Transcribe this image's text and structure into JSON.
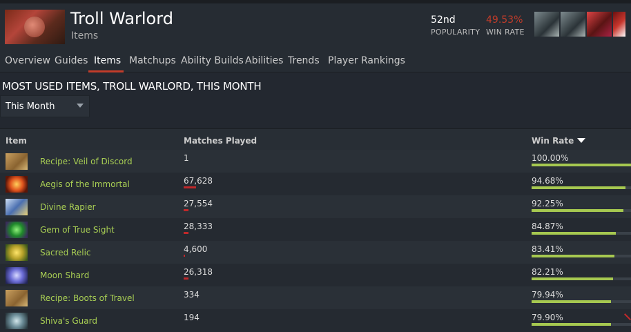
{
  "hero": {
    "name": "Troll Warlord",
    "subtitle": "Items",
    "popularity_value": "52nd",
    "popularity_label": "POPULARITY",
    "winrate_value": "49.53%",
    "winrate_label": "WIN RATE"
  },
  "nav": {
    "tabs": [
      "Overview",
      "Guides",
      "Items",
      "Matchups",
      "Ability Builds",
      "Abilities",
      "Trends",
      "Player Rankings"
    ],
    "active": "Items"
  },
  "section": {
    "title": "MOST USED ITEMS, TROLL WARLORD, THIS MONTH"
  },
  "filter": {
    "selected": "This Month"
  },
  "table": {
    "headers": {
      "item": "Item",
      "matches": "Matches Played",
      "winrate": "Win Rate"
    },
    "rows": [
      {
        "name": "Recipe: Veil of Discord",
        "icon": "recipe-scroll-icon",
        "matches": "1",
        "match_fraction": 0.0,
        "winrate": "100.00%",
        "winrate_fraction": 1.0
      },
      {
        "name": "Aegis of the Immortal",
        "icon": "aegis-icon",
        "matches": "67,628",
        "match_fraction": 0.175,
        "winrate": "94.68%",
        "winrate_fraction": 0.9468
      },
      {
        "name": "Divine Rapier",
        "icon": "rapier-icon",
        "matches": "27,554",
        "match_fraction": 0.07,
        "winrate": "92.25%",
        "winrate_fraction": 0.9225
      },
      {
        "name": "Gem of True Sight",
        "icon": "gem-icon",
        "matches": "28,333",
        "match_fraction": 0.072,
        "winrate": "84.87%",
        "winrate_fraction": 0.8487
      },
      {
        "name": "Sacred Relic",
        "icon": "sacred-relic-icon",
        "matches": "4,600",
        "match_fraction": 0.012,
        "winrate": "83.41%",
        "winrate_fraction": 0.8341
      },
      {
        "name": "Moon Shard",
        "icon": "moon-shard-icon",
        "matches": "26,318",
        "match_fraction": 0.068,
        "winrate": "82.21%",
        "winrate_fraction": 0.8221
      },
      {
        "name": "Recipe: Boots of Travel",
        "icon": "recipe-scroll-icon",
        "matches": "334",
        "match_fraction": 0.0,
        "winrate": "79.94%",
        "winrate_fraction": 0.7994
      },
      {
        "name": "Shiva's Guard",
        "icon": "shivas-guard-icon",
        "matches": "194",
        "match_fraction": 0.0,
        "winrate": "79.90%",
        "winrate_fraction": 0.799
      }
    ]
  },
  "colors": {
    "accent_red": "#c23c2a",
    "item_green": "#a9cf54",
    "winrate_bar": "#a6c850",
    "matches_bar": "#c0282a"
  }
}
